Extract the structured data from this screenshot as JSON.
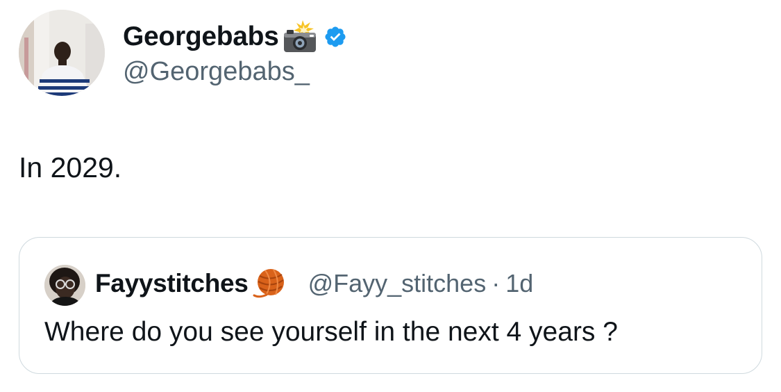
{
  "tweet": {
    "author": {
      "name": "Georgebabs",
      "name_emoji_icon": "camera-with-flash-icon",
      "verified_icon": "verified-badge-icon",
      "handle": "@Georgebabs_"
    },
    "text": "In 2029."
  },
  "quoted_tweet": {
    "author": {
      "name": "Fayystitches",
      "name_emoji_icon": "yarn-ball-icon",
      "handle": "@Fayy_stitches"
    },
    "separator": "·",
    "time": "1d",
    "text": "Where do you see yourself in the next 4 years ?"
  },
  "colors": {
    "text_primary": "#0f1419",
    "text_secondary": "#536471",
    "verified_blue": "#1d9bf0",
    "card_border": "#cfd9de",
    "yarn_orange": "#d9621a"
  }
}
